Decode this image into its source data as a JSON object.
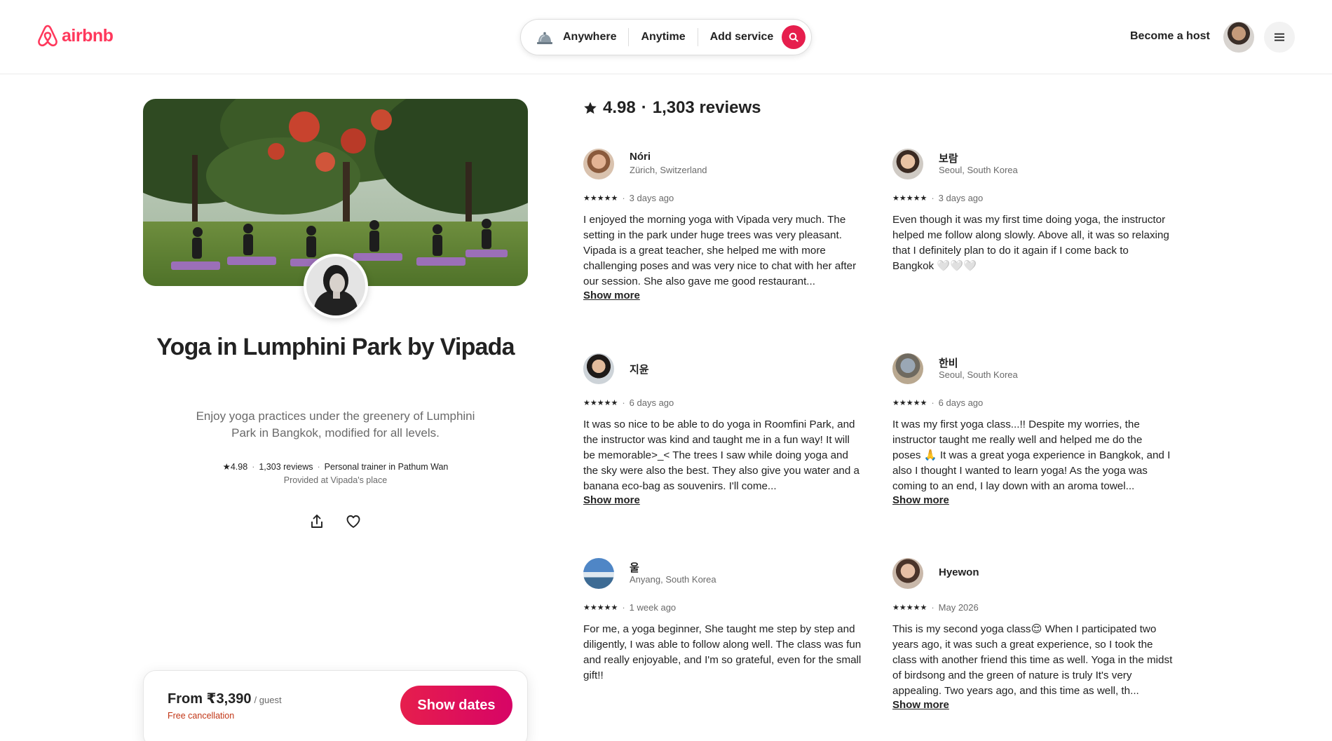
{
  "header": {
    "logo_text": "airbnb",
    "search": {
      "where": "Anywhere",
      "when": "Anytime",
      "service": "Add service"
    },
    "become_host": "Become a host"
  },
  "experience": {
    "title": "Yoga in Lumphini Park by Vipada",
    "description": "Enjoy yoga practices under the greenery of Lumphini Park in Bangkok, modified for all levels.",
    "rating": "4.98",
    "reviews_count": "1,303 reviews",
    "host_role": "Personal trainer in Pathum Wan",
    "provided_at": "Provided at Vipada's place"
  },
  "booking": {
    "price": "From ₹3,390",
    "unit": "/ guest",
    "cancellation": "Free cancellation",
    "cta": "Show dates"
  },
  "reviews_header": {
    "rating": "4.98",
    "count": "1,303 reviews"
  },
  "reviews": [
    {
      "name": "Nóri",
      "location": "Zürich, Switzerland",
      "stars": "★★★★★",
      "date": "3 days ago",
      "text": "I enjoyed the morning yoga with Vipada very much. The setting in the park under huge trees was very pleasant. Vipada is a great teacher, she helped me with more challenging poses and was very nice to chat with her after our session. She also gave me good restaurant...",
      "show_more": "Show more"
    },
    {
      "name": "보람",
      "location": "Seoul, South Korea",
      "stars": "★★★★★",
      "date": "3 days ago",
      "text": "Even though it was my first time doing yoga, the instructor helped me follow along slowly. Above all, it was so relaxing that I definitely plan to do it again if I come back to Bangkok 🤍🤍🤍",
      "show_more": ""
    },
    {
      "name": "지윤",
      "location": "",
      "stars": "★★★★★",
      "date": "6 days ago",
      "text": "It was so nice to be able to do yoga in Roomfini Park, and the instructor was kind and taught me in a fun way! It will be memorable>_< The trees I saw while doing yoga and the sky were also the best. They also give you water and a banana eco-bag as souvenirs. I'll come...",
      "show_more": "Show more"
    },
    {
      "name": "한비",
      "location": "Seoul, South Korea",
      "stars": "★★★★★",
      "date": "6 days ago",
      "text": "It was my first yoga class...!! Despite my worries, the instructor taught me really well and helped me do the poses 🙏 It was a great yoga experience in Bangkok, and I also I thought I wanted to learn yoga! As the yoga was coming to an end, I lay down with an aroma towel...",
      "show_more": "Show more"
    },
    {
      "name": "울",
      "location": "Anyang, South Korea",
      "stars": "★★★★★",
      "date": "1 week ago",
      "text": "For me, a yoga beginner, She taught me step by step and diligently, I was able to follow along well. The class was fun and really enjoyable, and I'm so grateful, even for the small gift!!",
      "show_more": ""
    },
    {
      "name": "Hyewon",
      "location": "",
      "stars": "★★★★★",
      "date": "May 2026",
      "text": "This is my second yoga class😌 When I participated two years ago, it was such a great experience, so I took the class with another friend this time as well. Yoga in the midst of birdsong and the green of nature is truly It's very appealing. Two years ago, and this time as well, th...",
      "show_more": "Show more"
    }
  ],
  "icons": {
    "logo": "airbnb-logo-icon",
    "service": "bell-service-icon",
    "search": "search-icon",
    "menu": "hamburger-icon",
    "share": "share-icon",
    "save": "heart-icon",
    "star": "star-icon"
  },
  "colors": {
    "brand": "#ff385c",
    "cta": "#e61e4d",
    "cancellation": "#c13515",
    "text": "#222222",
    "muted": "#6a6a6a"
  }
}
